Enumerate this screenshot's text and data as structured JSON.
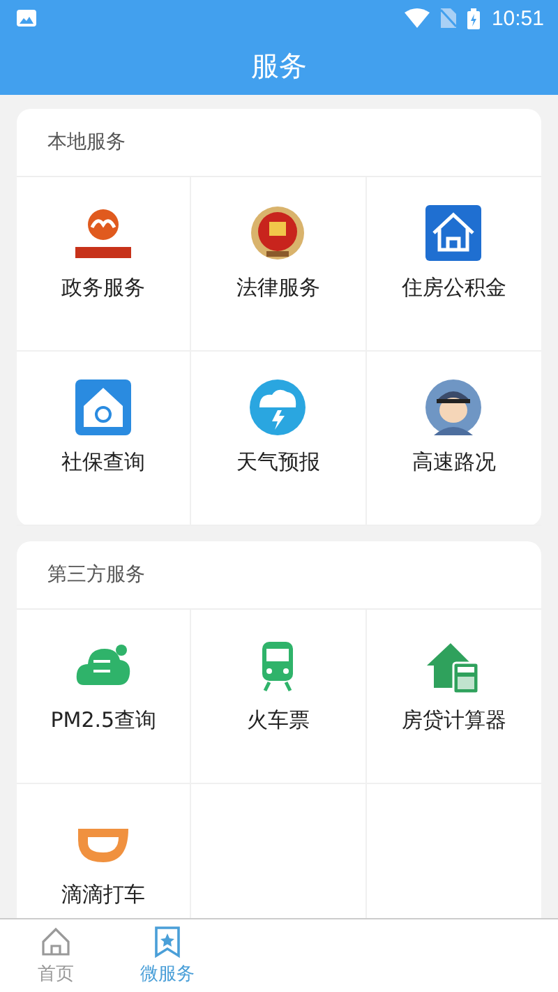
{
  "status_bar": {
    "time": "10:51"
  },
  "title": "服务",
  "sections": [
    {
      "title": "本地服务",
      "items": [
        {
          "label": "政务服务",
          "kind": "gov"
        },
        {
          "label": "法律服务",
          "kind": "law"
        },
        {
          "label": "住房公积金",
          "kind": "house"
        },
        {
          "label": "社保查询",
          "kind": "social"
        },
        {
          "label": "天气预报",
          "kind": "weather"
        },
        {
          "label": "高速路况",
          "kind": "police"
        }
      ]
    },
    {
      "title": "第三方服务",
      "items": [
        {
          "label": "PM2.5查询",
          "kind": "pm"
        },
        {
          "label": "火车票",
          "kind": "train"
        },
        {
          "label": "房贷计算器",
          "kind": "calc"
        },
        {
          "label": "滴滴打车",
          "kind": "didi"
        }
      ]
    }
  ],
  "bottom_nav": [
    {
      "label": "首页",
      "kind": "home",
      "selected": false
    },
    {
      "label": "微服务",
      "kind": "bookmark",
      "selected": true
    }
  ]
}
